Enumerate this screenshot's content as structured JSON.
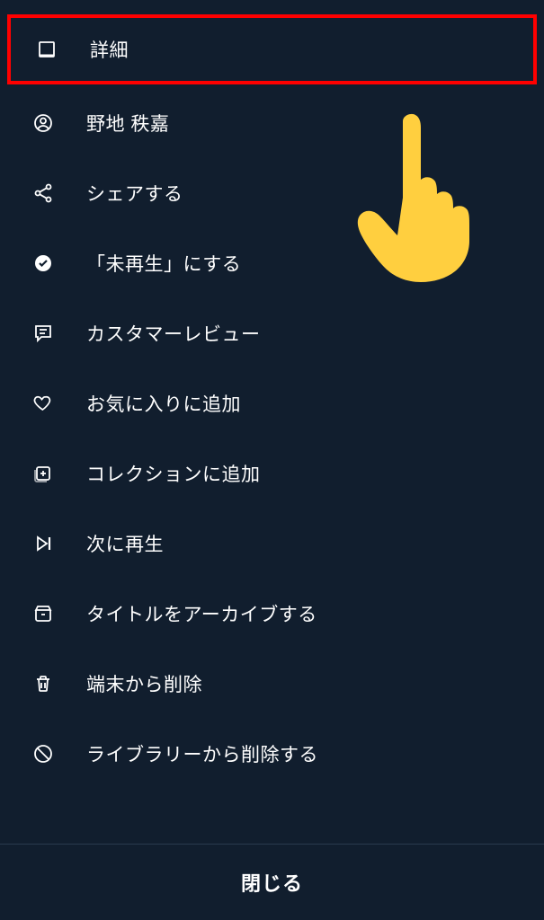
{
  "menu": {
    "items": [
      {
        "label": "詳細",
        "icon": "window",
        "highlighted": true
      },
      {
        "label": "野地 秩嘉",
        "icon": "person",
        "highlighted": false
      },
      {
        "label": "シェアする",
        "icon": "share",
        "highlighted": false
      },
      {
        "label": "「未再生」にする",
        "icon": "check-circle",
        "highlighted": false
      },
      {
        "label": "カスタマーレビュー",
        "icon": "review",
        "highlighted": false
      },
      {
        "label": "お気に入りに追加",
        "icon": "heart",
        "highlighted": false
      },
      {
        "label": "コレクションに追加",
        "icon": "collection-add",
        "highlighted": false
      },
      {
        "label": "次に再生",
        "icon": "play-next",
        "highlighted": false
      },
      {
        "label": "タイトルをアーカイブする",
        "icon": "archive",
        "highlighted": false
      },
      {
        "label": "端末から削除",
        "icon": "trash",
        "highlighted": false
      },
      {
        "label": "ライブラリーから削除する",
        "icon": "prohibit",
        "highlighted": false
      }
    ]
  },
  "close_button": {
    "label": "閉じる"
  },
  "annotation": {
    "pointer_target_index": 0
  }
}
